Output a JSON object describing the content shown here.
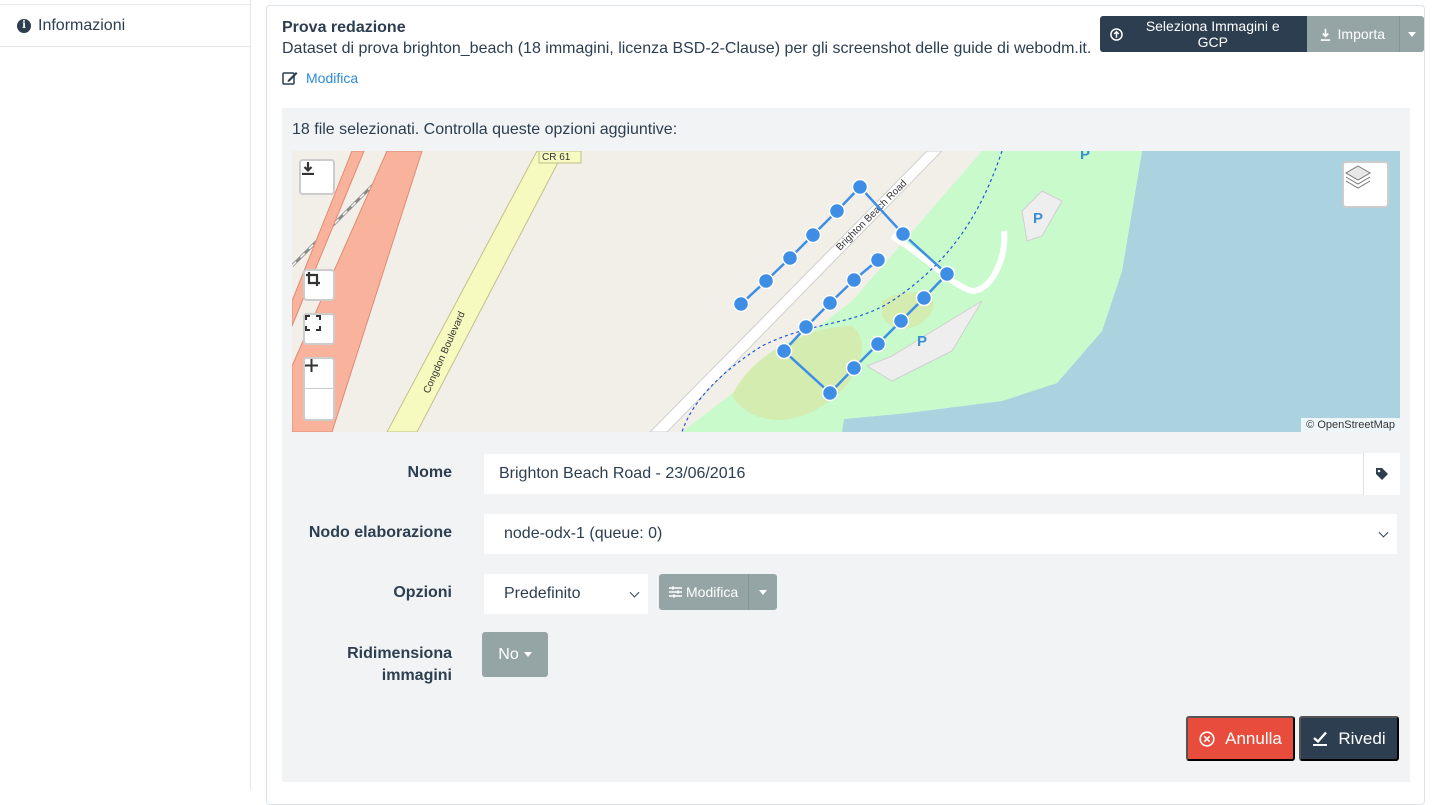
{
  "sidebar": {
    "items": [
      {
        "label": "Informazioni",
        "icon": "info-icon"
      }
    ]
  },
  "project": {
    "title": "Prova redazione",
    "description": "Dataset di prova brighton_beach (18 immagini, licenza BSD-2-Clause) per gli screenshot delle guide di webodm.it.",
    "edit_label": "Modifica"
  },
  "toolbar": {
    "select_images_label": "Seleziona Immagini e GCP",
    "import_label": "Importa"
  },
  "upload": {
    "selected_text": "18 file selezionati. Controlla queste opzioni aggiuntive:",
    "map": {
      "attribution": "© OpenStreetMap",
      "labels": {
        "road1": "CR 61",
        "road2": "Congdon Boulevard",
        "road3": "Brighton Beach Road",
        "parking": "P"
      },
      "colors": {
        "land": "#f2efe9",
        "water": "#aad3df",
        "park": "#c8facc",
        "trunk": "#f9b29c",
        "secondary": "#f7fabf",
        "point": "#3f8ee6"
      }
    },
    "form": {
      "name_label": "Nome",
      "name_value": "Brighton Beach Road - 23/06/2016",
      "node_label": "Nodo elaborazione",
      "node_value": "node-odx-1 (queue: 0)",
      "options_label": "Opzioni",
      "options_value": "Predefinito",
      "options_edit_label": "Modifica",
      "resize_label_line1": "Ridimensiona",
      "resize_label_line2": "immagini",
      "resize_value": "No"
    },
    "actions": {
      "cancel_label": "Annulla",
      "review_label": "Rivedi"
    }
  }
}
